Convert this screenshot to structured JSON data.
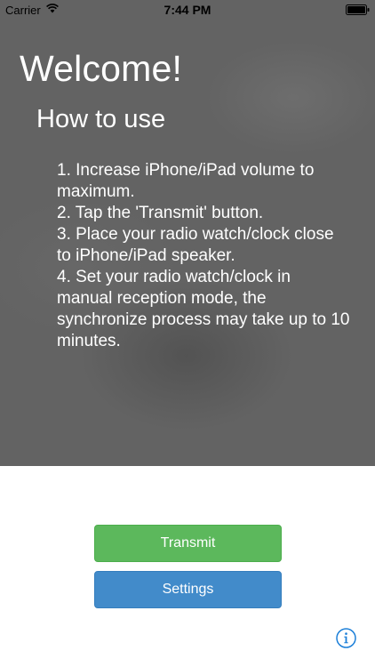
{
  "status_bar": {
    "carrier": "Carrier",
    "time": "7:44 PM",
    "wifi_icon": "wifi-icon",
    "battery_icon": "battery-icon"
  },
  "overlay": {
    "title": "Welcome!",
    "subtitle": "How to use",
    "steps": [
      "1. Increase iPhone/iPad volume to maximum.",
      "2. Tap the 'Transmit' button.",
      "3. Place your radio watch/clock close to iPhone/iPad speaker.",
      "4. Set your radio watch/clock in manual reception mode, the synchronize process may take up to 10 minutes."
    ]
  },
  "actions": {
    "transmit_label": "Transmit",
    "settings_label": "Settings",
    "info_icon": "info-icon"
  },
  "colors": {
    "overlay": "#636363",
    "transmit": "#5cb85c",
    "settings": "#428bca",
    "info": "#1a7ed8"
  }
}
